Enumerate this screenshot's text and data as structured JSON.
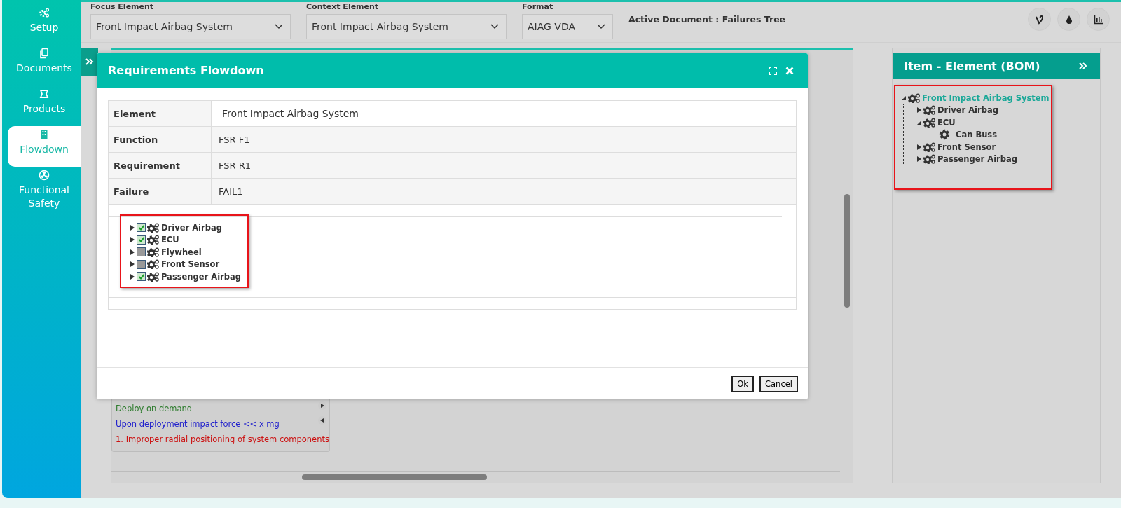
{
  "sidebar": {
    "items": [
      {
        "label": "Setup",
        "selected": false
      },
      {
        "label": "Documents",
        "selected": false
      },
      {
        "label": "Products",
        "selected": false
      },
      {
        "label": "Flowdown",
        "selected": true
      },
      {
        "label": "Functional Safety",
        "selected": false
      }
    ]
  },
  "toolbar": {
    "fields": [
      {
        "label": "Focus Element",
        "value": "Front Impact Airbag System"
      },
      {
        "label": "Context Element",
        "value": "Front Impact Airbag System"
      },
      {
        "label": "Format",
        "value": "AIAG VDA"
      }
    ],
    "active_document": "Active Document : Failures Tree"
  },
  "canvas": {
    "card_lines": [
      {
        "text": "Deploy on demand",
        "color": "#2a7a2a"
      },
      {
        "text": "Upon deployment impact force << x mg",
        "color": "#2222cc"
      },
      {
        "text": "1. Improper radial positioning of system components",
        "color": "#cc1111"
      }
    ]
  },
  "modal": {
    "title": "Requirements Flowdown",
    "rows": [
      {
        "label": "Element",
        "value": "Front Impact Airbag System"
      },
      {
        "label": "Function",
        "value": "FSR F1"
      },
      {
        "label": "Requirement",
        "value": "FSR R1"
      },
      {
        "label": "Failure",
        "value": "FAIL1"
      }
    ],
    "tree": [
      {
        "label": "Driver Airbag",
        "checked": true
      },
      {
        "label": "ECU",
        "checked": true
      },
      {
        "label": "Flywheel",
        "checked": false
      },
      {
        "label": "Front Sensor",
        "checked": false
      },
      {
        "label": "Passenger Airbag",
        "checked": true
      }
    ],
    "buttons": [
      "Ok",
      "Cancel"
    ]
  },
  "bom_panel": {
    "title": "Item - Element (BOM)",
    "tree": [
      {
        "label": "Front Impact Airbag System",
        "kind": "assembly",
        "expanded": true,
        "selected": true,
        "children": [
          {
            "label": "Driver Airbag",
            "kind": "assembly",
            "expanded": false,
            "selected": false
          },
          {
            "label": "ECU",
            "kind": "assembly",
            "expanded": true,
            "selected": false,
            "children": [
              {
                "label": "Can Buss",
                "kind": "part",
                "selected": false
              }
            ]
          },
          {
            "label": "Front Sensor",
            "kind": "assembly",
            "expanded": false,
            "selected": false
          },
          {
            "label": "Passenger Airbag",
            "kind": "assembly",
            "expanded": false,
            "selected": false
          }
        ]
      }
    ]
  }
}
